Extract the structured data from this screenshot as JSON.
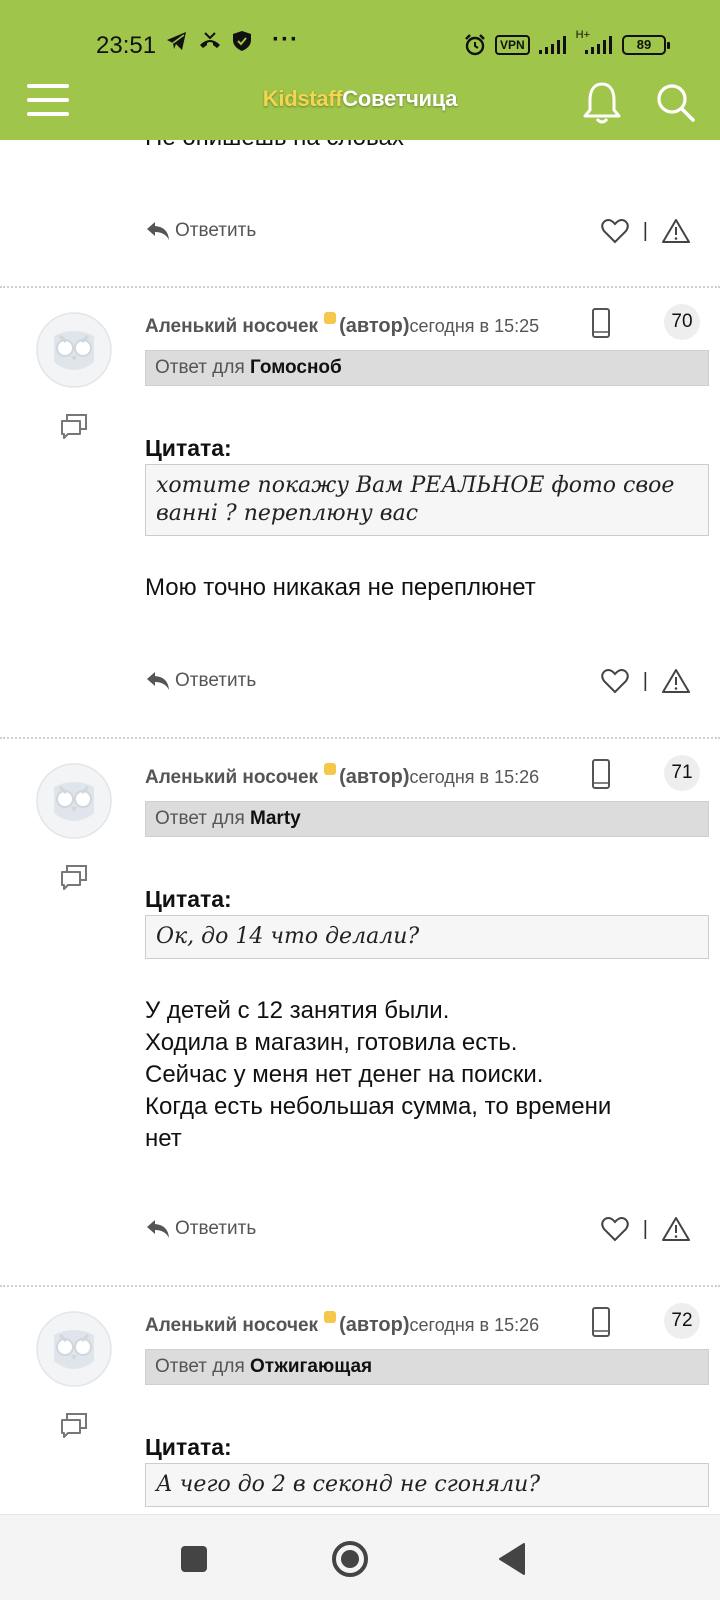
{
  "status_bar": {
    "time": "23:51",
    "dots": "···",
    "vpn_label": "VPN",
    "network_label": "H+",
    "battery": "89"
  },
  "header": {
    "logo_part1": "Kidstaff",
    "logo_part2": "Советчица"
  },
  "prev_post": {
    "cut_text": "Не опишешь на словах",
    "reply_label": "Ответить"
  },
  "posts": [
    {
      "author": "Аленький носочек",
      "role": "(автор)",
      "time": "сегодня в 15:25",
      "number": "70",
      "reply_prefix": "Ответ для ",
      "reply_to": "Гомосноб",
      "quote_title": "Цитата:",
      "quote": "хотите покажу Вам РЕАЛЬНОЕ фото свое ванні ? переплюну вас",
      "body": "Мою точно никакая не переплюнет",
      "reply_label": "Ответить"
    },
    {
      "author": "Аленький носочек",
      "role": "(автор)",
      "time": "сегодня в 15:26",
      "number": "71",
      "reply_prefix": "Ответ для ",
      "reply_to": "Marty",
      "quote_title": "Цитата:",
      "quote": "Ок, до 14 что делали?",
      "body_lines": [
        "У детей с 12 занятия были.",
        "Ходила в магазин, готовила есть.",
        "Сейчас у меня нет денег на поиски.",
        "Когда есть небольшая сумма, то времени",
        "нет"
      ],
      "reply_label": "Ответить"
    },
    {
      "author": "Аленький носочек",
      "role": "(автор)",
      "time": "сегодня в 15:26",
      "number": "72",
      "reply_prefix": "Ответ для ",
      "reply_to": "Отжигающая",
      "quote_title": "Цитата:",
      "quote": "А чего до 2 в секонд не сгоняли?"
    }
  ],
  "colors": {
    "header_bg": "#9fc54a",
    "logo_accent": "#f3d64f",
    "reply_bar_bg": "#dcdcdc",
    "author_dot": "#f5c84c"
  }
}
